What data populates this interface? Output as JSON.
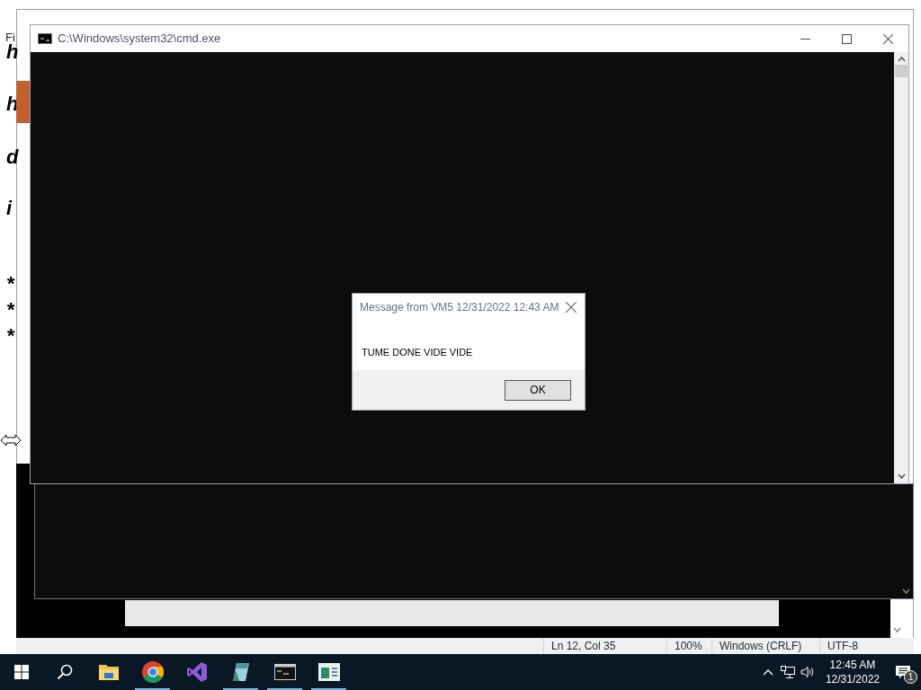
{
  "notepad": {
    "menu": [
      "Fi"
    ],
    "lines": [
      "h",
      "h",
      "d",
      "i",
      "*",
      "*",
      "*"
    ],
    "status_bar": [
      "Ln 12, Col 35",
      "100%",
      "Windows (CRLF)",
      "UTF-8"
    ]
  },
  "cmd_window": {
    "title": "C:\\Windows\\system32\\cmd.exe"
  },
  "dialog": {
    "title": "Message from VM5 12/31/2022 12:43 AM",
    "message": "TUME DONE VIDE VIDE",
    "buttons": [
      "OK"
    ]
  },
  "taskbar": {
    "apps": [
      {
        "kind": "explorer",
        "running": false
      },
      {
        "kind": "chrome",
        "running": true
      },
      {
        "kind": "studio",
        "running": false
      },
      {
        "kind": "notepad",
        "running": true
      },
      {
        "kind": "console",
        "running": true
      },
      {
        "kind": "window",
        "running": true
      }
    ],
    "clock": {
      "time": "12:45 AM",
      "date": "12/31/2022"
    },
    "notifications": "1"
  }
}
